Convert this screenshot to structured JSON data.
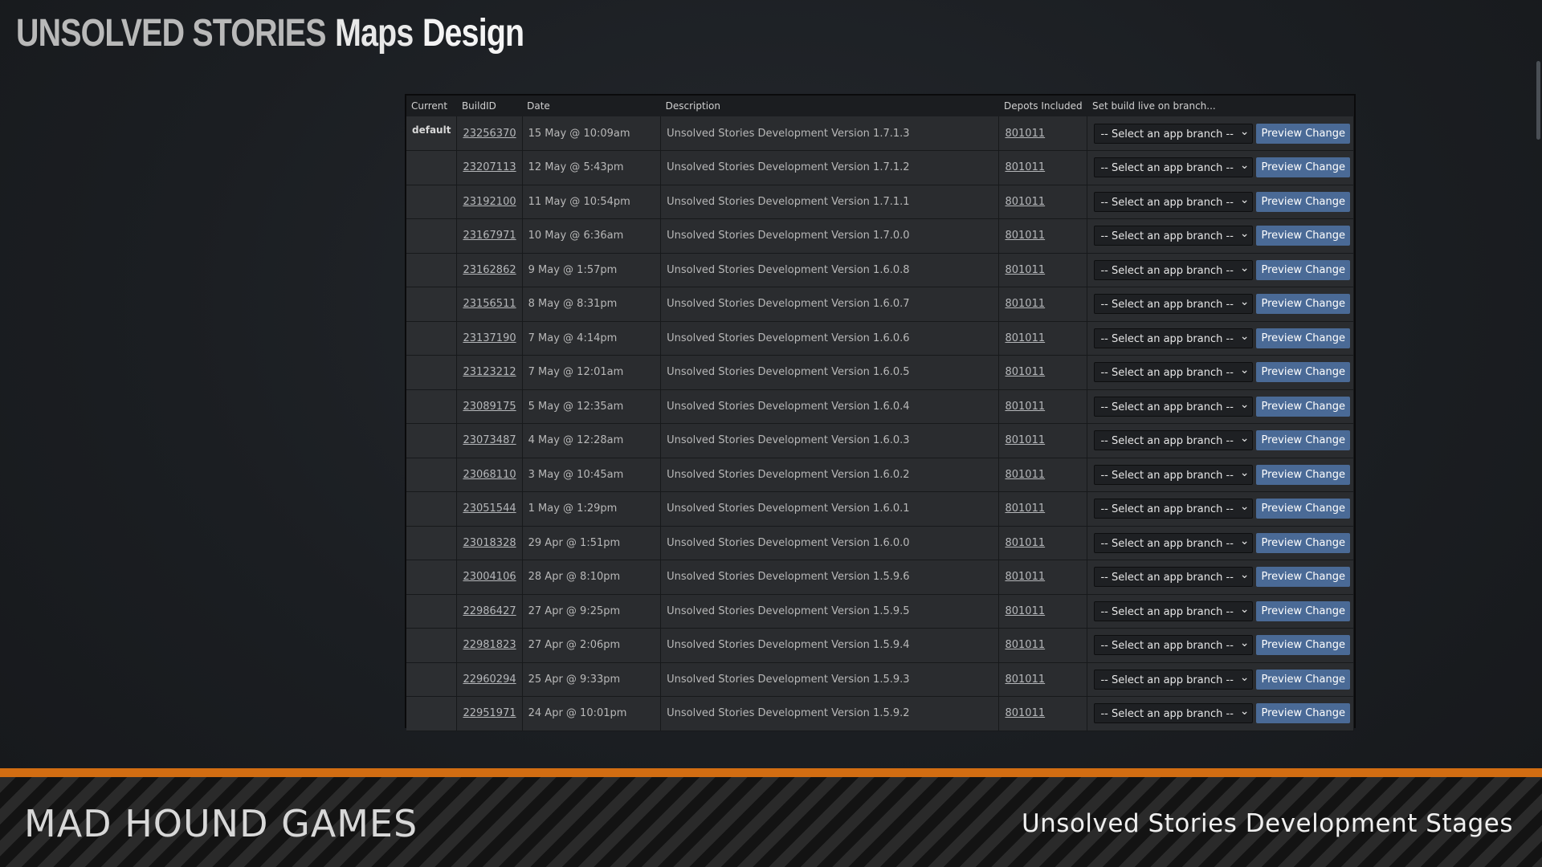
{
  "header": {
    "part1": "UNSOLVED STORIES",
    "part2": "Maps",
    "part3": "Design"
  },
  "table": {
    "columns": [
      "Current",
      "BuildID",
      "Date",
      "Description",
      "Depots Included",
      "Set build live on branch..."
    ],
    "select_placeholder": "-- Select an app branch --",
    "button_label": "Preview Change",
    "rows": [
      {
        "current": "default",
        "build_id": "23256370",
        "date": "15 May @ 10:09am",
        "description": "Unsolved Stories Development Version 1.7.1.3",
        "depot": "801011"
      },
      {
        "current": "",
        "build_id": "23207113",
        "date": "12 May @ 5:43pm",
        "description": "Unsolved Stories Development Version 1.7.1.2",
        "depot": "801011"
      },
      {
        "current": "",
        "build_id": "23192100",
        "date": "11 May @ 10:54pm",
        "description": "Unsolved Stories Development Version 1.7.1.1",
        "depot": "801011"
      },
      {
        "current": "",
        "build_id": "23167971",
        "date": "10 May @ 6:36am",
        "description": "Unsolved Stories Development Version 1.7.0.0",
        "depot": "801011"
      },
      {
        "current": "",
        "build_id": "23162862",
        "date": "9 May @ 1:57pm",
        "description": "Unsolved Stories Development Version 1.6.0.8",
        "depot": "801011"
      },
      {
        "current": "",
        "build_id": "23156511",
        "date": "8 May @ 8:31pm",
        "description": "Unsolved Stories Development Version 1.6.0.7",
        "depot": "801011"
      },
      {
        "current": "",
        "build_id": "23137190",
        "date": "7 May @ 4:14pm",
        "description": "Unsolved Stories Development Version 1.6.0.6",
        "depot": "801011"
      },
      {
        "current": "",
        "build_id": "23123212",
        "date": "7 May @ 12:01am",
        "description": "Unsolved Stories Development Version 1.6.0.5",
        "depot": "801011"
      },
      {
        "current": "",
        "build_id": "23089175",
        "date": "5 May @ 12:35am",
        "description": "Unsolved Stories Development Version 1.6.0.4",
        "depot": "801011"
      },
      {
        "current": "",
        "build_id": "23073487",
        "date": "4 May @ 12:28am",
        "description": "Unsolved Stories Development Version 1.6.0.3",
        "depot": "801011"
      },
      {
        "current": "",
        "build_id": "23068110",
        "date": "3 May @ 10:45am",
        "description": "Unsolved Stories Development Version 1.6.0.2",
        "depot": "801011"
      },
      {
        "current": "",
        "build_id": "23051544",
        "date": "1 May @ 1:29pm",
        "description": "Unsolved Stories Development Version 1.6.0.1",
        "depot": "801011"
      },
      {
        "current": "",
        "build_id": "23018328",
        "date": "29 Apr @ 1:51pm",
        "description": "Unsolved Stories Development Version 1.6.0.0",
        "depot": "801011"
      },
      {
        "current": "",
        "build_id": "23004106",
        "date": "28 Apr @ 8:10pm",
        "description": "Unsolved Stories Development Version 1.5.9.6",
        "depot": "801011"
      },
      {
        "current": "",
        "build_id": "22986427",
        "date": "27 Apr @ 9:25pm",
        "description": "Unsolved Stories Development Version 1.5.9.5",
        "depot": "801011"
      },
      {
        "current": "",
        "build_id": "22981823",
        "date": "27 Apr @ 2:06pm",
        "description": "Unsolved Stories Development Version 1.5.9.4",
        "depot": "801011"
      },
      {
        "current": "",
        "build_id": "22960294",
        "date": "25 Apr @ 9:33pm",
        "description": "Unsolved Stories Development Version 1.5.9.3",
        "depot": "801011"
      },
      {
        "current": "",
        "build_id": "22951971",
        "date": "24 Apr @ 10:01pm",
        "description": "Unsolved Stories Development Version 1.5.9.2",
        "depot": "801011"
      }
    ]
  },
  "footer": {
    "left": "MAD HOUND GAMES",
    "right": "Unsolved Stories Development Stages"
  },
  "colors": {
    "accent_orange": "#d26d12",
    "button_blue": "#4a6a96"
  },
  "icons": {
    "select_chevron": "chevron-down-icon",
    "corner": "minimize-icon"
  }
}
